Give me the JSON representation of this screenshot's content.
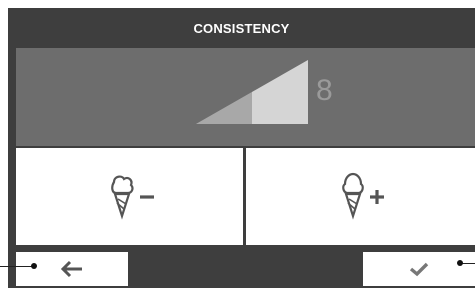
{
  "header": {
    "title": "CONSISTENCY"
  },
  "consistency": {
    "level": "8",
    "max_level": 10,
    "fill_fraction": 0.5
  },
  "buttons": {
    "decrease": {
      "icon": "ice-cream-minus-icon",
      "symbol": "−"
    },
    "increase": {
      "icon": "ice-cream-plus-icon",
      "symbol": "+"
    },
    "back": {
      "icon": "arrow-left-icon"
    },
    "confirm": {
      "icon": "checkmark-icon"
    }
  },
  "colors": {
    "screen_bg": "#3e3e3e",
    "panel_bg": "#6d6d6d",
    "level_fill": "#b4b4b4",
    "level_light": "#d8d8d8",
    "icon": "#555555"
  }
}
